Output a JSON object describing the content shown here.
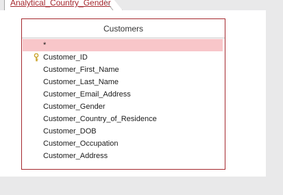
{
  "document_tab": {
    "label": "Analytical_Country_Gender"
  },
  "table": {
    "title": "Customers",
    "fields": [
      {
        "label": "*",
        "selected": true,
        "primary_key": false
      },
      {
        "label": "Customer_ID",
        "selected": false,
        "primary_key": true
      },
      {
        "label": "Customer_First_Name",
        "selected": false,
        "primary_key": false
      },
      {
        "label": "Customer_Last_Name",
        "selected": false,
        "primary_key": false
      },
      {
        "label": "Customer_Email_Address",
        "selected": false,
        "primary_key": false
      },
      {
        "label": "Customer_Gender",
        "selected": false,
        "primary_key": false
      },
      {
        "label": "Customer_Country_of_Residence",
        "selected": false,
        "primary_key": false
      },
      {
        "label": "Customer_DOB",
        "selected": false,
        "primary_key": false
      },
      {
        "label": "Customer_Occupation",
        "selected": false,
        "primary_key": false
      },
      {
        "label": "Customer_Address",
        "selected": false,
        "primary_key": false
      }
    ]
  },
  "colors": {
    "accent": "#a4262c",
    "selection": "#f8c6c9",
    "key_icon": "#c9a227",
    "canvas_gray": "#e9e9ea"
  },
  "icons": {
    "primary_key": "key-icon"
  }
}
